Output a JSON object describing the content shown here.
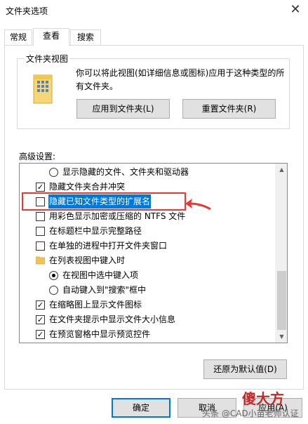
{
  "window": {
    "title": "文件夹选项",
    "close_glyph": "✕"
  },
  "tabs": [
    {
      "label": "常规"
    },
    {
      "label": "查看"
    },
    {
      "label": "搜索"
    }
  ],
  "folder_views": {
    "group_label": "文件夹视图",
    "description": "你可以将此视图(如详细信息或图标)应用于这种类型的所有文件夹。",
    "apply_button": "应用到文件夹(L)",
    "reset_button": "重置文件夹(R)"
  },
  "advanced": {
    "label": "高级设置:",
    "items": [
      {
        "type": "radio",
        "checked": false,
        "label": "显示隐藏的文件、文件夹和驱动器"
      },
      {
        "type": "checkbox",
        "checked": true,
        "label": "隐藏文件夹合并冲突"
      },
      {
        "type": "checkbox",
        "checked": false,
        "label": "隐藏已知文件类型的扩展名",
        "selected": true
      },
      {
        "type": "checkbox",
        "checked": false,
        "label": "用彩色显示加密或压缩的 NTFS 文件"
      },
      {
        "type": "checkbox",
        "checked": false,
        "label": "在标题栏中显示完整路径"
      },
      {
        "type": "checkbox",
        "checked": false,
        "label": "在单独的进程中打开文件夹窗口"
      },
      {
        "type": "folder",
        "label": "在列表视图中键入时"
      },
      {
        "type": "radio",
        "checked": true,
        "label": "在视图中选中键入项"
      },
      {
        "type": "radio",
        "checked": false,
        "label": "自动键入到\"搜索\"框中"
      },
      {
        "type": "checkbox",
        "checked": true,
        "label": "在缩略图上显示文件图标"
      },
      {
        "type": "checkbox",
        "checked": true,
        "label": "在文件夹提示中显示文件大小信息"
      },
      {
        "type": "checkbox",
        "checked": true,
        "label": "在预览窗格中显示预览控件"
      }
    ],
    "checkmark": "✓"
  },
  "scrollbar": {
    "up": "▲",
    "down": "▼"
  },
  "buttons": {
    "restore_defaults": "还原为默认值(D)",
    "ok": "确定",
    "cancel": "取消",
    "apply": "应用(A)"
  },
  "overlay": {
    "watermark": "头条 @CAD小苗老师认证",
    "logo": "傻大方"
  },
  "colors": {
    "annotation": "#e53935",
    "selection": "#0078d7"
  }
}
